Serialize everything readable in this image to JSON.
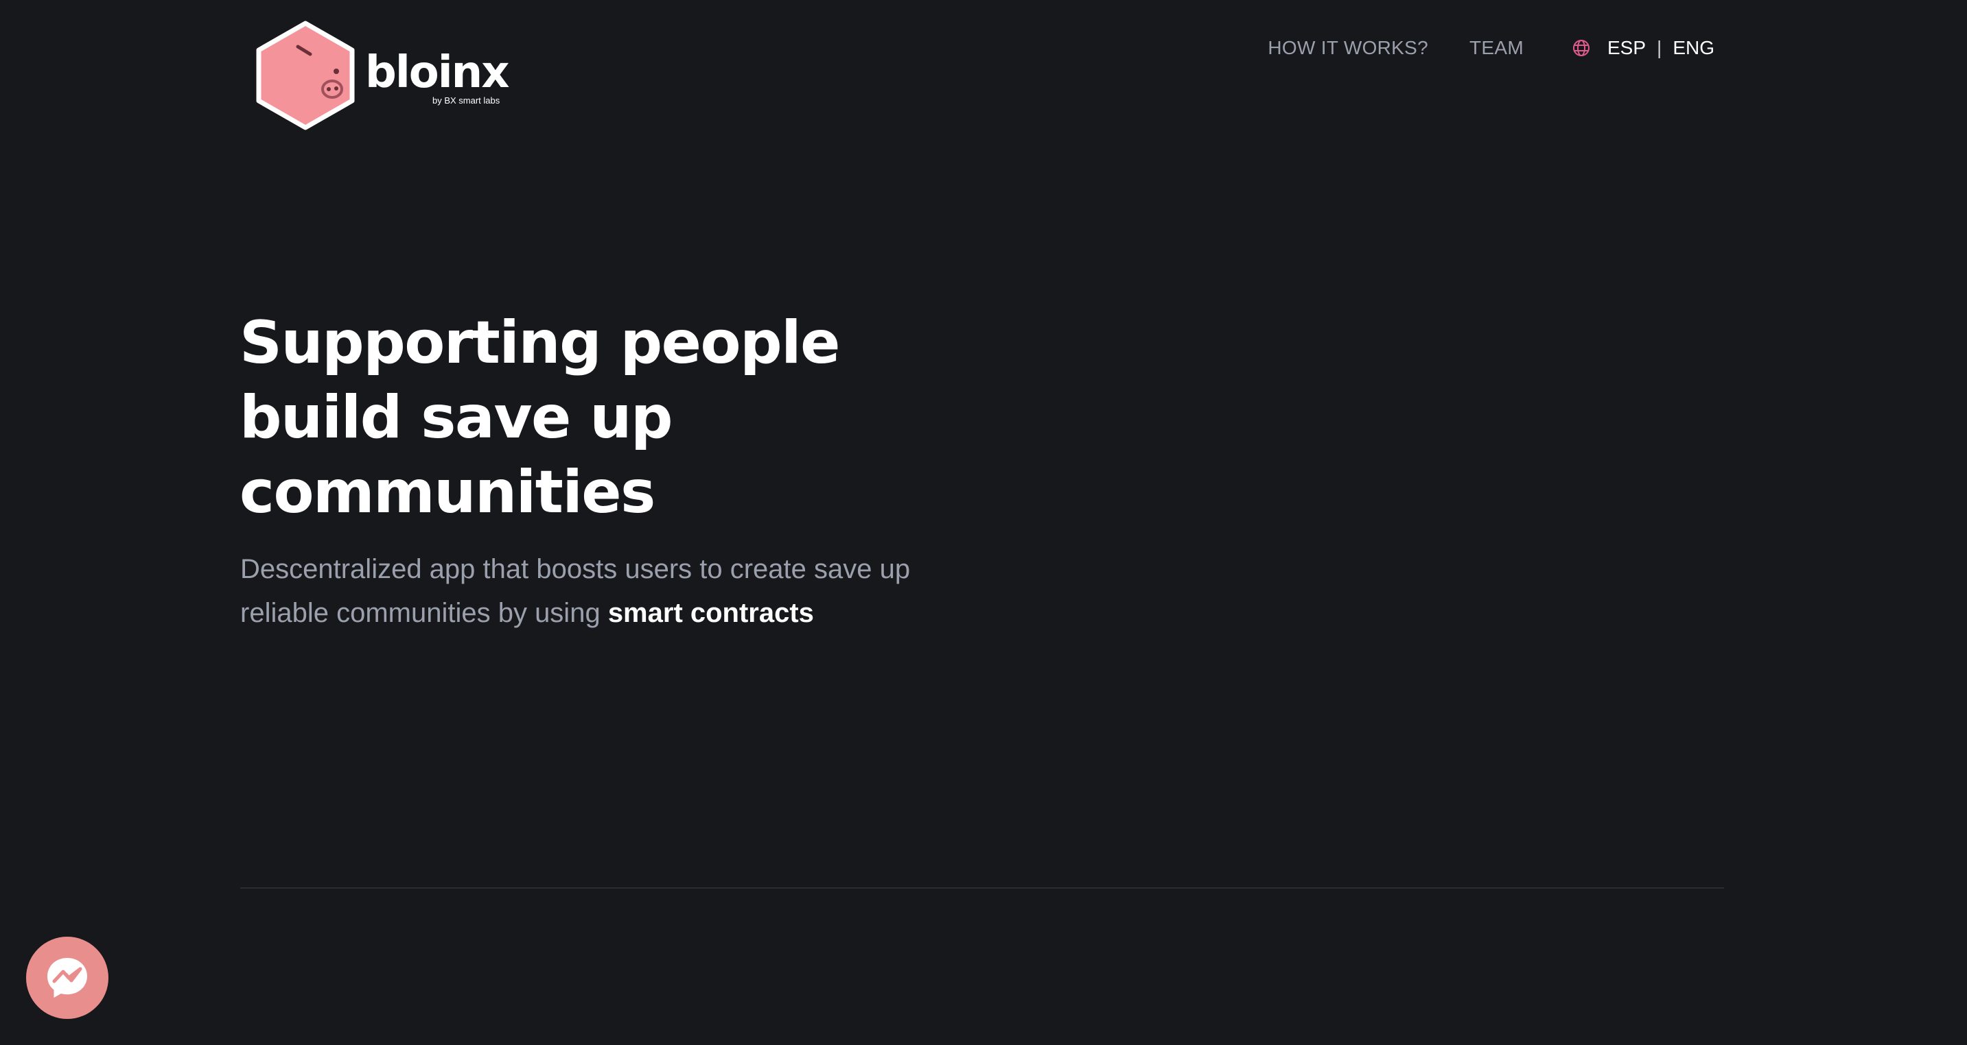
{
  "brand": {
    "name": "bloinx",
    "tagline": "by BX smart labs",
    "accent_color": "#f4939a",
    "icon": "piggy-cube-logo"
  },
  "nav": {
    "items": [
      {
        "label": "HOW IT WORKS?"
      },
      {
        "label": "TEAM"
      }
    ],
    "language": {
      "icon": "globe-icon",
      "options": [
        "ESP",
        "ENG"
      ],
      "separator": "|"
    }
  },
  "hero": {
    "title": "Supporting people build save up communities",
    "subtitle_lead": "Descentralized app that boosts users to create save up reliable communities by using ",
    "subtitle_emphasis": "smart contracts"
  },
  "chat_widget": {
    "icon": "messenger-icon",
    "color": "#e88e8d"
  },
  "colors": {
    "background": "#17181c",
    "muted_text": "#9ba0ad",
    "divider": "#2a2c33"
  }
}
